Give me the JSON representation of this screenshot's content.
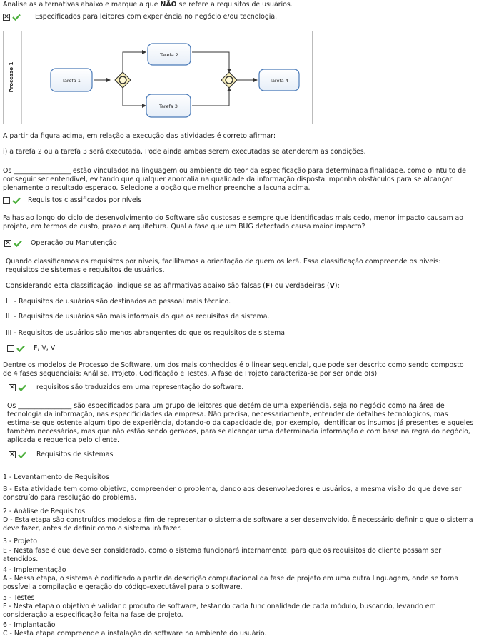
{
  "q1": {
    "prompt_pre": "Analise as alternativas abaixo e marque a que ",
    "prompt_bold": "NÃO",
    "prompt_post": " se refere a requisitos de usuários.",
    "answer": "Especificados para leitores com experiência no negócio e/ou tecnologia.",
    "checked": true
  },
  "diagram": {
    "pool_label": "Processo 1",
    "tasks": [
      "Tarefa 1",
      "Tarefa 2",
      "Tarefa 3",
      "Tarefa 4"
    ]
  },
  "q2": {
    "intro": "A partir da figura acima, em relação a execução das atividades é correto afirmar:",
    "statement": "i) a tarefa 2 ou a tarefa 3 será executada. Pode ainda ambas serem executadas se atenderem as condições."
  },
  "q3": {
    "prompt": "Os _________________ estão vinculados na linguagem ou ambiente do teor da especificação para determinada finalidade, como o intuito de conseguir ser entendível, evitando que qualquer anomalia na qualidade da informação disposta imponha obstáculos para se alcançar plenamente o resultado esperado. Selecione a opção que melhor preenche a lacuna acima.",
    "answer": "Requisitos classificados por níveis",
    "checked": false
  },
  "q4": {
    "prompt": "Falhas ao longo do ciclo de desenvolvimento do Software são custosas e sempre que identificadas mais cedo, menor impacto causam ao projeto, em termos de custo, prazo e arquitetura. Qual a fase que um BUG detectado causa maior impacto?",
    "answer": "Operação ou Manutenção",
    "checked": true
  },
  "q5": {
    "intro": "Quando classificamos os requisitos por níveis, facilitamos a orientação de quem os lerá. Essa classificação compreende os níveis: requisitos de sistemas e requisitos de usuários.",
    "instr_pre": "Considerando esta classificação, indique se as afirmativas abaixo são falsas (",
    "instr_f": "F",
    "instr_mid": ") ou verdadeiras (",
    "instr_v": "V",
    "instr_post": "):",
    "items": [
      "I   - Requisitos de usuários são destinados ao pessoal mais técnico.",
      "II  - Requisitos de usuários são mais informais do que os requisitos de sistema.",
      "III - Requisitos de usuários são menos abrangentes do que os requisitos de sistema."
    ],
    "answer": "F, V, V",
    "checked": false
  },
  "q6": {
    "prompt": "Dentre os modelos de Processo de Software, um dos mais conhecidos é o linear sequencial, que pode ser descrito como sendo composto de 4 fases sequenciais: Análise, Projeto, Codificação e Testes. A fase de Projeto caracteriza-se por ser onde o(s)",
    "answer": "requisitos são traduzidos em uma representação do software.",
    "checked": true
  },
  "q7": {
    "prompt": "Os ________________ são especificados para um grupo de leitores que detém de uma experiência, seja no negócio como na área de tecnologia da informação, nas especificidades da empresa. Não precisa, necessariamente, entender de detalhes tecnológicos, mas estima-se que ostente algum tipo de experiência, dotando-o da capacidade de, por exemplo, identificar os insumos já presentes e aqueles também necessários, mas que não estão sendo gerados, para se alcançar uma determinada informação e com base na regra do negócio, aplicada e requerida pelo cliente.",
    "answer": "Requisitos de sistemas",
    "checked": true
  },
  "q8": {
    "pairs": [
      {
        "head": "1 - Levantamento de Requisitos",
        "body": "B - Esta atividade tem como objetivo, compreender o problema, dando aos desenvolvedores e usuários, a mesma visão do que deve ser construído para resolução do problema."
      },
      {
        "head": "2 - Análise de Requisitos",
        "body": "D - Esta etapa são construídos modelos a fim de representar o sistema de software a ser desenvolvido. É necessário definir o que o sistema deve fazer, antes de definir como o sistema irá fazer."
      },
      {
        "head": "3 - Projeto",
        "body": "E - Nesta fase é que deve ser considerado, como o sistema funcionará internamente, para que os requisitos do cliente possam ser atendidos."
      },
      {
        "head": "4 - Implementação",
        "body": "A - Nessa etapa, o sistema é codificado a partir da descrição computacional da fase de projeto em uma outra linguagem, onde se torna possível a compilação e geração do código-executável para o software."
      },
      {
        "head": "5 - Testes",
        "body": "F - Nesta etapa o objetivo é validar o produto de software, testando cada funcionalidade de cada módulo, buscando, levando em consideração a especificação feita na fase de projeto."
      },
      {
        "head": "6 - Implantação",
        "body": "C - Nesta etapa compreende a instalação do software no ambiente do usuário."
      }
    ]
  }
}
